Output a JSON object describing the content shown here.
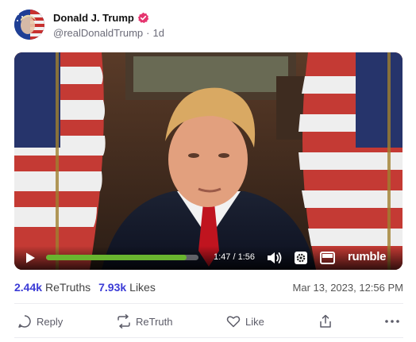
{
  "post": {
    "display_name": "Donald J. Trump",
    "handle": "@realDonaldTrump",
    "separator": "·",
    "age": "1d",
    "verified_color": "#e5356f"
  },
  "video": {
    "time": "1:47 / 1:56",
    "progress_fraction": 0.92,
    "brand": "rumble",
    "progress_color": "#69b42f"
  },
  "stats": {
    "retruths_count": "2.44k",
    "retruths_label": "ReTruths",
    "likes_count": "7.93k",
    "likes_label": "Likes",
    "timestamp": "Mar 13, 2023, 12:56 PM"
  },
  "actions": {
    "reply": "Reply",
    "retruth": "ReTruth",
    "like": "Like"
  },
  "icons": [
    "verified-badge-icon",
    "play-icon",
    "volume-icon",
    "settings-icon",
    "picture-in-picture-icon",
    "reply-icon",
    "retruth-icon",
    "like-icon",
    "share-icon",
    "more-icon"
  ]
}
